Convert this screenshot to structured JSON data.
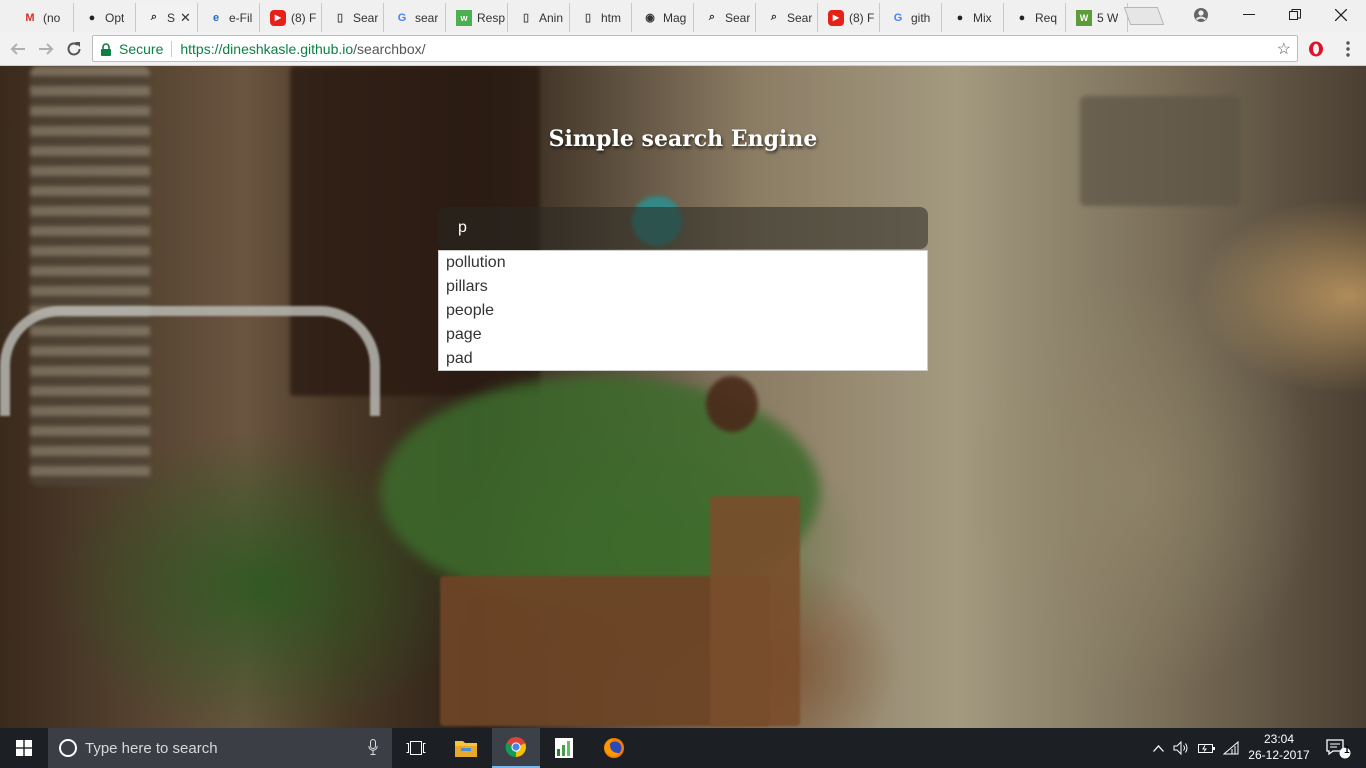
{
  "tabs": [
    {
      "title": "(no",
      "icon": "gmail-icon",
      "color": "#d93025"
    },
    {
      "title": "Opt",
      "icon": "github-icon",
      "color": "#222"
    },
    {
      "title": "S",
      "icon": "search-icon",
      "color": "#333",
      "active": true
    },
    {
      "title": "e-Fil",
      "icon": "edge-icon",
      "color": "#1e6fc7"
    },
    {
      "title": "(8) F",
      "icon": "youtube-icon",
      "color": "#e62117"
    },
    {
      "title": "Sear",
      "icon": "page-icon",
      "color": "#555"
    },
    {
      "title": "sear",
      "icon": "google-icon",
      "color": "#4285f4"
    },
    {
      "title": "Resp",
      "icon": "w3-icon",
      "color": "#4caf50"
    },
    {
      "title": "Anin",
      "icon": "page-icon",
      "color": "#555"
    },
    {
      "title": "htm",
      "icon": "page-icon",
      "color": "#555"
    },
    {
      "title": "Mag",
      "icon": "browser-icon",
      "color": "#333"
    },
    {
      "title": "Sear",
      "icon": "search-icon",
      "color": "#333"
    },
    {
      "title": "Sear",
      "icon": "search-icon",
      "color": "#333"
    },
    {
      "title": "(8) F",
      "icon": "youtube-icon",
      "color": "#e62117"
    },
    {
      "title": "gith",
      "icon": "google-icon",
      "color": "#4285f4"
    },
    {
      "title": "Mix",
      "icon": "github-icon",
      "color": "#222"
    },
    {
      "title": "Req",
      "icon": "github-icon",
      "color": "#222"
    },
    {
      "title": "5 W",
      "icon": "wh-icon",
      "color": "#5d9c3a"
    }
  ],
  "address_bar": {
    "security_label": "Secure",
    "url_host": "https://dineshkasle.github.io",
    "url_path": "/searchbox/"
  },
  "page": {
    "title": "Simple search Engine",
    "search_value": "p",
    "suggestions": [
      "pollution",
      "pillars",
      "people",
      "page",
      "pad"
    ]
  },
  "taskbar": {
    "search_placeholder": "Type here to search",
    "time": "23:04",
    "date": "26-12-2017",
    "notification_count": "1"
  },
  "colors": {
    "secure_green": "#0b8043",
    "taskbar_bg": "#1c1f24",
    "active_accent": "#76b9ed"
  }
}
